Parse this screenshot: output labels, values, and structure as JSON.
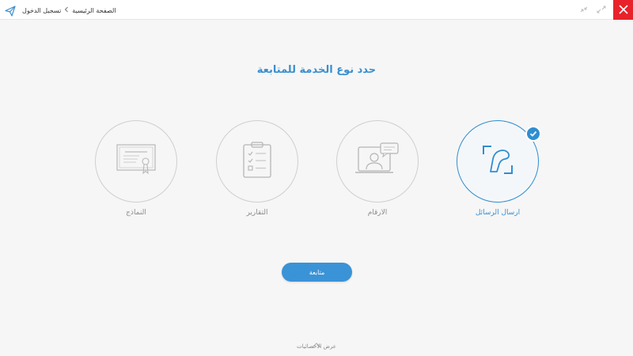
{
  "header": {
    "breadcrumb": {
      "home": "الصفحة الرئيسية",
      "current": "تسجيل الدخول"
    }
  },
  "main": {
    "title": "حدد نوع الخدمة للمتابعة",
    "services": [
      {
        "label": "ارسال الرسائل",
        "icon": "message-edit-icon",
        "selected": true
      },
      {
        "label": "الارقام",
        "icon": "video-presenter-icon",
        "selected": false
      },
      {
        "label": "التقارير",
        "icon": "clipboard-checklist-icon",
        "selected": false
      },
      {
        "label": "النماذج",
        "icon": "certificate-icon",
        "selected": false
      }
    ],
    "continue_label": "متابعة"
  },
  "footer": {
    "stats_label": "عرض الاحصائيات"
  },
  "colors": {
    "accent": "#3a8fcf",
    "close": "#e8222b",
    "inactive": "#cfcfcf"
  }
}
